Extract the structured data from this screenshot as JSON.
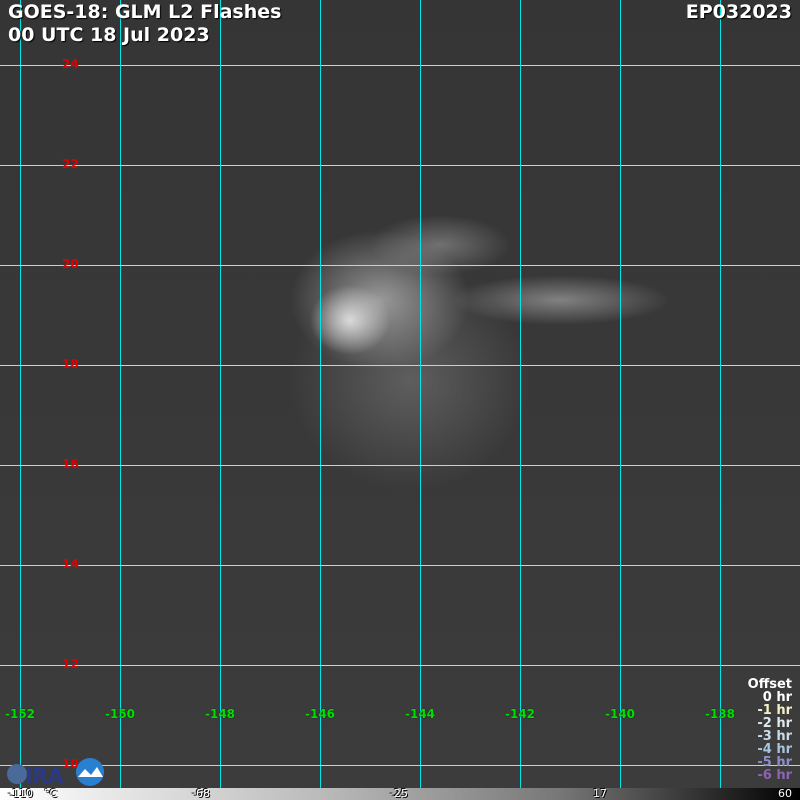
{
  "header": {
    "title": "GOES-18: GLM L2 Flashes",
    "datetime": "00 UTC 18 Jul 2023",
    "storm_id": "EP032023"
  },
  "lat_labels": [
    "24",
    "22",
    "20",
    "18",
    "16",
    "14",
    "12",
    "10"
  ],
  "lon_labels": [
    "-152",
    "-150",
    "-148",
    "-146",
    "-144",
    "-142",
    "-140",
    "-138"
  ],
  "legend": {
    "title": "Offset",
    "items": [
      {
        "label": "0 hr",
        "color": "#ffffff"
      },
      {
        "label": "-1 hr",
        "color": "#f4f0c8"
      },
      {
        "label": "-2 hr",
        "color": "#e0e8ec"
      },
      {
        "label": "-3 hr",
        "color": "#c8dcec"
      },
      {
        "label": "-4 hr",
        "color": "#a8c4e0"
      },
      {
        "label": "-5 hr",
        "color": "#8c90c8"
      },
      {
        "label": "-6 hr",
        "color": "#8c64b4"
      }
    ]
  },
  "colorbar": {
    "labels": [
      "-110",
      "°C",
      "-68",
      "-25",
      "17",
      "60"
    ]
  },
  "logos": [
    "CIRA",
    "RAMMB"
  ]
}
